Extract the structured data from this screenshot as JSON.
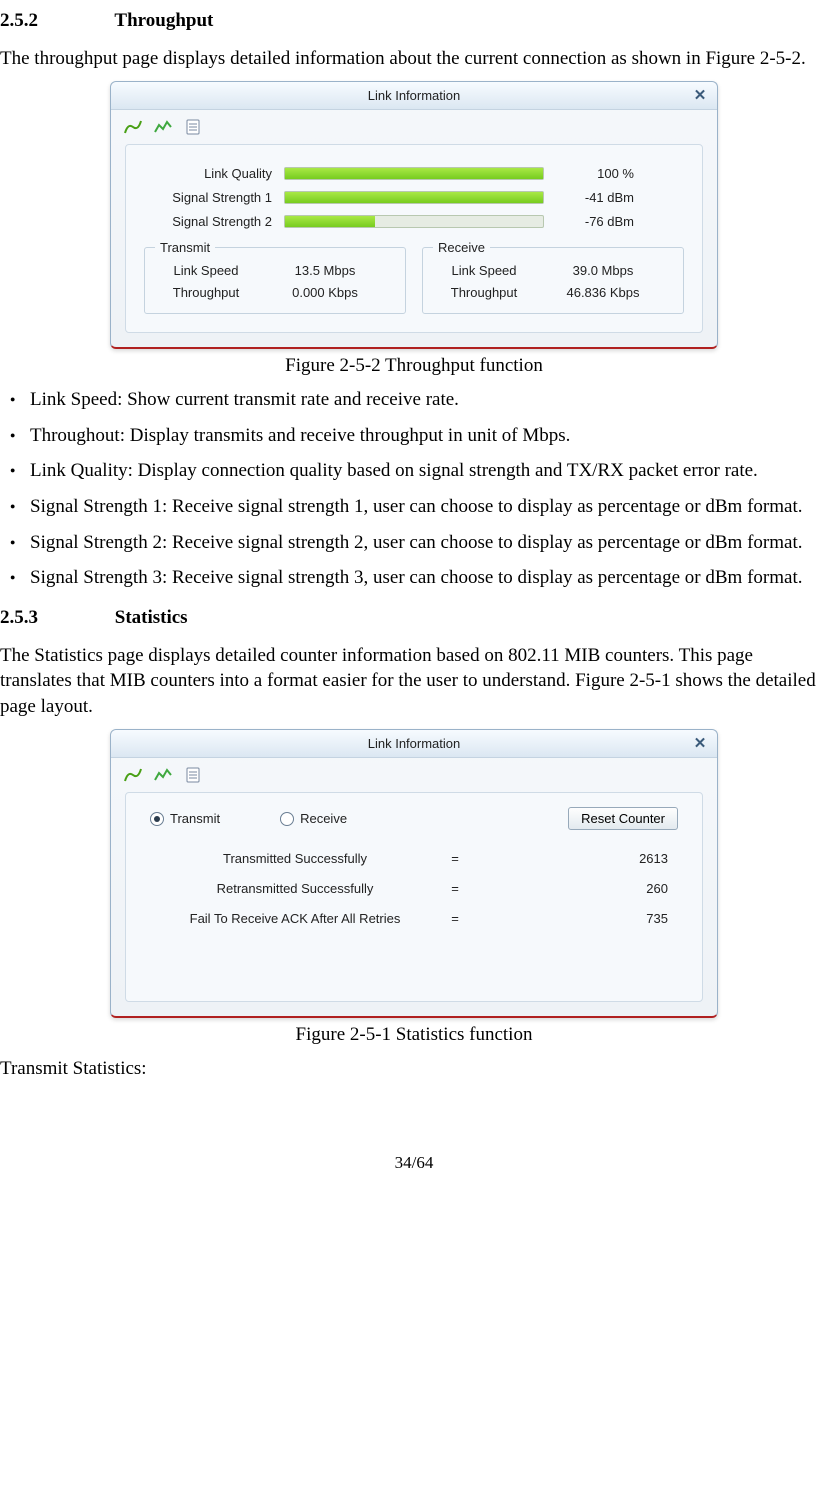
{
  "section1": {
    "num": "2.5.2",
    "title": "Throughput",
    "intro": "The throughput page displays detailed information about the current connection as shown in Figure 2-5-2.",
    "caption": "Figure 2-5-2 Throughput function"
  },
  "dialog1": {
    "title": "Link Information",
    "icons": {
      "signal": "signal-icon",
      "chart": "chart-icon",
      "doc": "document-icon"
    },
    "rows": [
      {
        "label": "Link Quality",
        "pct": 100,
        "value": "100 %"
      },
      {
        "label": "Signal Strength 1",
        "pct": 100,
        "value": "-41 dBm"
      },
      {
        "label": "Signal Strength 2",
        "pct": 35,
        "value": "-76 dBm"
      }
    ],
    "transmit": {
      "legend": "Transmit",
      "linkspeed_label": "Link Speed",
      "linkspeed_value": "13.5 Mbps",
      "throughput_label": "Throughput",
      "throughput_value": "0.000 Kbps"
    },
    "receive": {
      "legend": "Receive",
      "linkspeed_label": "Link Speed",
      "linkspeed_value": "39.0 Mbps",
      "throughput_label": "Throughput",
      "throughput_value": "46.836 Kbps"
    }
  },
  "bullets": [
    "Link Speed: Show current transmit rate and receive rate.",
    "Throughout: Display transmits and receive throughput in unit of Mbps.",
    "Link Quality: Display connection quality based on signal strength and TX/RX packet error rate.",
    "Signal Strength 1: Receive signal strength 1, user can choose to display as percentage or dBm format.",
    "Signal Strength 2: Receive signal strength 2, user can choose to display as percentage or dBm format.",
    "Signal Strength 3: Receive signal strength 3, user can choose to display as percentage or dBm format."
  ],
  "section2": {
    "num": "2.5.3",
    "title": "Statistics",
    "intro": "The Statistics page displays detailed counter information based on 802.11 MIB counters. This page translates that MIB counters into a format easier for the user to understand. Figure 2-5-1 shows the detailed page layout.",
    "caption": "Figure 2-5-1 Statistics function",
    "closing": "Transmit Statistics:"
  },
  "dialog2": {
    "title": "Link Information",
    "radio_transmit": "Transmit",
    "radio_receive": "Receive",
    "reset_label": "Reset Counter",
    "stats": [
      {
        "label": "Transmitted Successfully",
        "eq": "=",
        "value": "2613"
      },
      {
        "label": "Retransmitted Successfully",
        "eq": "=",
        "value": "260"
      },
      {
        "label": "Fail To Receive ACK After All Retries",
        "eq": "=",
        "value": "735"
      }
    ]
  },
  "pagenum": "34/64"
}
